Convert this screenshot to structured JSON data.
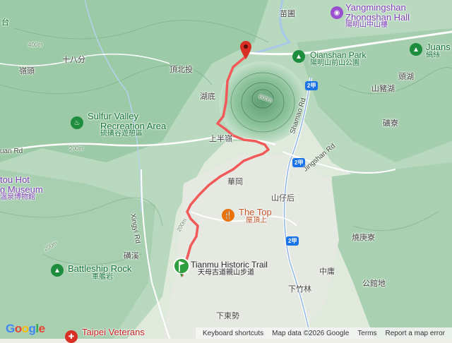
{
  "places": {
    "miaopu": "苗圃",
    "shibafen": "十八分",
    "lingtou": "嶺頭",
    "dingbeitou": "頂北投",
    "hudi": "湖底",
    "shangbanling": "上半嶺",
    "huagang": "華岡",
    "shanzaihou": "山仔后",
    "toushanhu": "頭湖",
    "shanzhuhu": "山豬湖",
    "guliao": "礦寮",
    "shaogengliao": "燒庚寮",
    "zhongyong": "中庸",
    "gongguandi": "公館地",
    "xiazhulin": "下竹林",
    "xiadongshi": "下東勢",
    "lixi": "磺溪"
  },
  "roads": {
    "xingyi": "Xingyi Rd",
    "jingshan": "Jingshan Rd",
    "shamao": "Shamao Rd",
    "quan": "uan Rd",
    "shield_2jia_1": "2甲",
    "shield_2jia_2": "2甲",
    "shield_2jia_3": "2甲"
  },
  "contours": [
    "400m",
    "200m",
    "200m",
    "200m",
    "600m"
  ],
  "pois": {
    "zhongshan_hall_en": "Yangmingshan",
    "zhongshan_hall_en2": "Zhongshan Hall",
    "zhongshan_hall_zh": "陽明山中山樓",
    "qianshan_en": "Qianshan Park",
    "qianshan_zh": "陽明山前山公園",
    "juans_en": "Juans",
    "juans_zh": "絹絲",
    "sulfur_en1": "Sulfur Valley",
    "sulfur_en2": "Recreation Area",
    "sulfur_zh": "硫磺谷遊憩區",
    "hotspring_en1": "tou Hot",
    "hotspring_en2": "g Museum",
    "hotspring_zh": "溫泉博物館",
    "thetop_en": "The Top",
    "thetop_zh": "屋頂上",
    "tianmu_en": "Tianmu Historic Trail",
    "tianmu_zh": "天母古道親山步道",
    "battleship_en": "Battleship Rock",
    "battleship_zh": "軍艦岩",
    "veterans_en": "Taipei Veterans",
    "top_left_zh": "台"
  },
  "route": {
    "color": "#f25a5a",
    "start_marker_color": "#2e9e3e",
    "end_marker_color": "#d93025"
  },
  "footer": {
    "shortcuts": "Keyboard shortcuts",
    "mapdata": "Map data ©2026 Google",
    "terms": "Terms",
    "report": "Report a map error",
    "google": [
      "G",
      "o",
      "o",
      "g",
      "l",
      "e"
    ]
  }
}
